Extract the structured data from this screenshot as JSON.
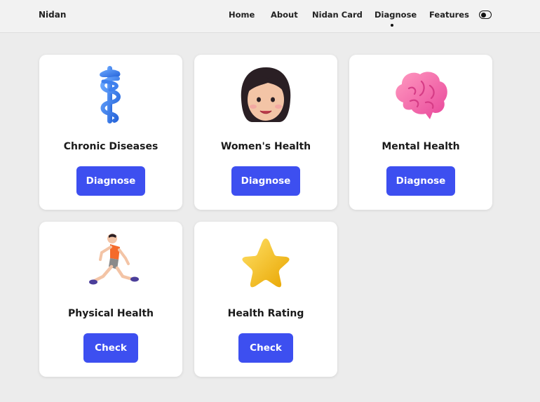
{
  "nav": {
    "brand": "Nidan",
    "items": [
      "Home",
      "About",
      "Nidan Card",
      "Diagnose",
      "Features"
    ],
    "active": "Diagnose"
  },
  "cards": [
    {
      "title": "Chronic Diseases",
      "button": "Diagnose",
      "icon": "medical-symbol-icon"
    },
    {
      "title": "Women's Health",
      "button": "Diagnose",
      "icon": "woman-face-icon"
    },
    {
      "title": "Mental Health",
      "button": "Diagnose",
      "icon": "brain-icon"
    },
    {
      "title": "Physical Health",
      "button": "Check",
      "icon": "running-person-icon"
    },
    {
      "title": "Health Rating",
      "button": "Check",
      "icon": "star-icon"
    }
  ],
  "colors": {
    "accent": "#3d4ff0",
    "background": "#ececec",
    "card": "#ffffff"
  }
}
